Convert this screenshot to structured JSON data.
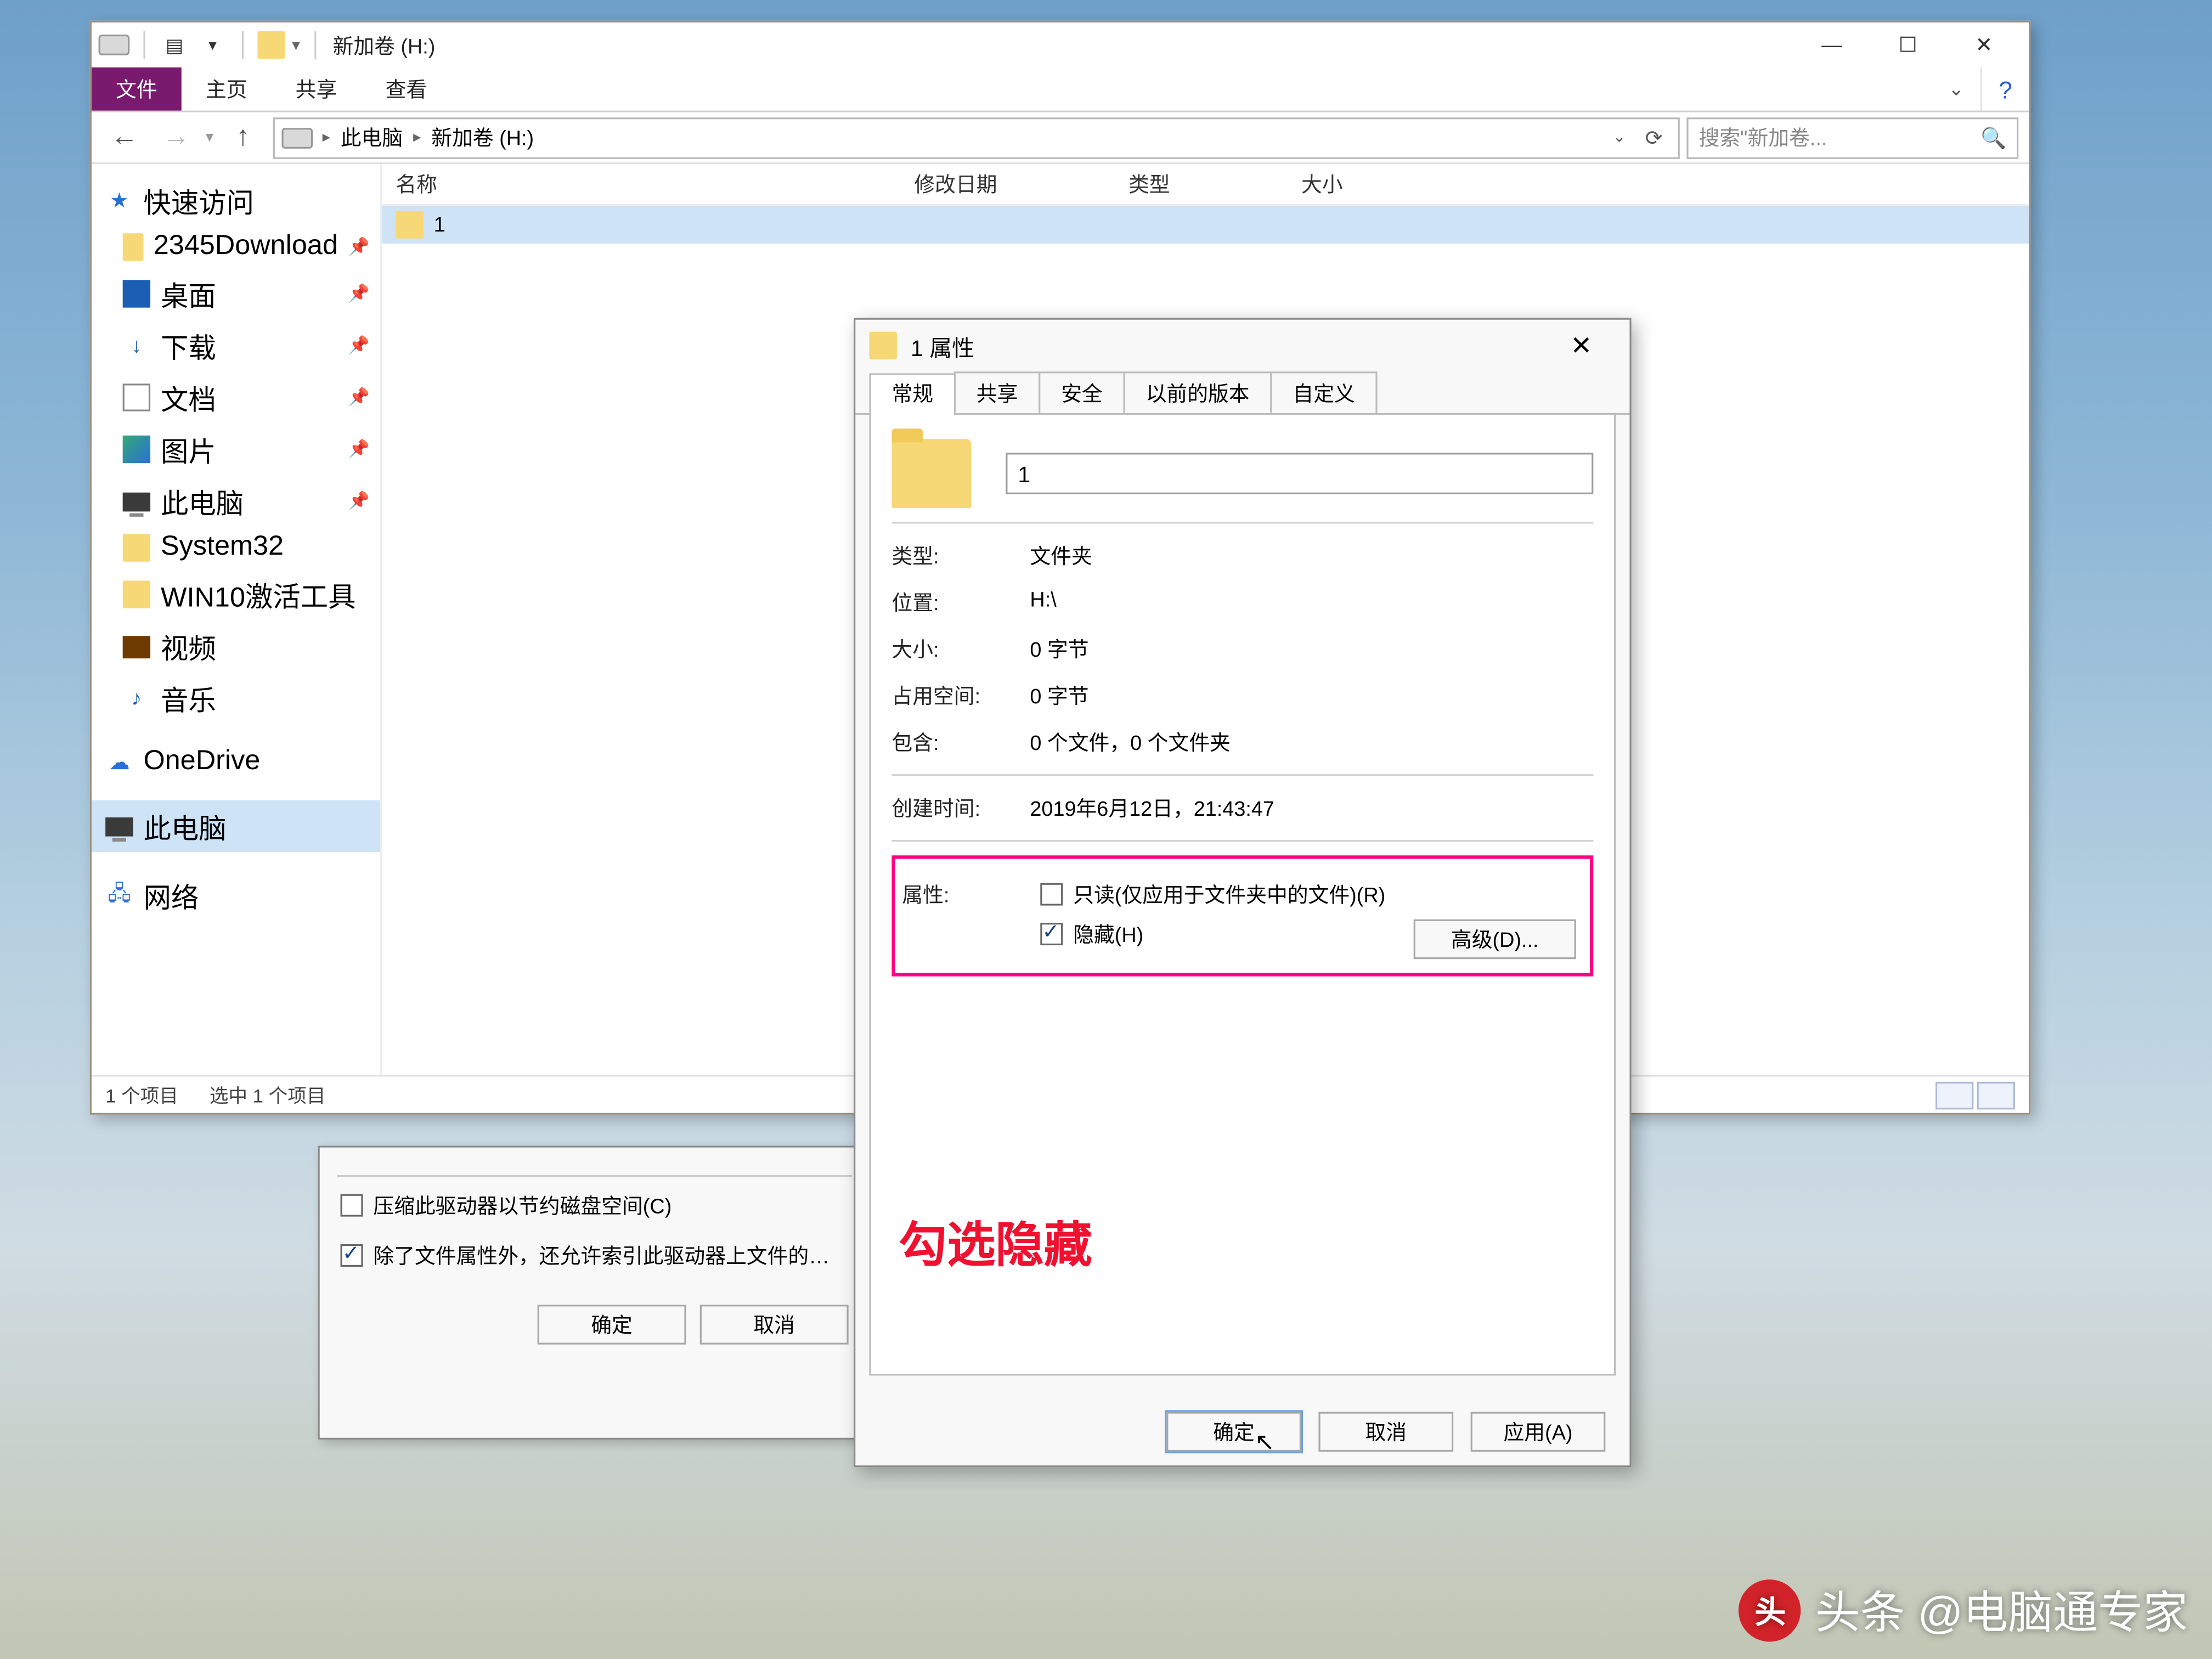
{
  "explorer": {
    "title": "新加卷 (H:)",
    "ribbon": {
      "file": "文件",
      "home": "主页",
      "share": "共享",
      "view": "查看"
    },
    "breadcrumb": {
      "a": "此电脑",
      "b": "新加卷 (H:)"
    },
    "search_placeholder": "搜索\"新加卷...",
    "columns": {
      "name": "名称",
      "date": "修改日期",
      "type": "类型",
      "size": "大小"
    },
    "sidebar": {
      "quick": "快速访问",
      "items": [
        {
          "label": "2345Download"
        },
        {
          "label": "桌面"
        },
        {
          "label": "下载"
        },
        {
          "label": "文档"
        },
        {
          "label": "图片"
        },
        {
          "label": "此电脑"
        },
        {
          "label": "System32"
        },
        {
          "label": "WIN10激活工具"
        },
        {
          "label": "视频"
        },
        {
          "label": "音乐"
        }
      ],
      "onedrive": "OneDrive",
      "thispc": "此电脑",
      "network": "网络"
    },
    "file_row_name": "1",
    "status": {
      "count": "1 个项目",
      "sel": "选中 1 个项目"
    }
  },
  "driveprops": {
    "compress": "压缩此驱动器以节约磁盘空间(C)",
    "index": "除了文件属性外，还允许索引此驱动器上文件的…",
    "ok": "确定",
    "cancel": "取消"
  },
  "props": {
    "title": "1 属性",
    "tabs": {
      "general": "常规",
      "share": "共享",
      "security": "安全",
      "prev": "以前的版本",
      "custom": "自定义"
    },
    "name_value": "1",
    "rows": {
      "type_l": "类型:",
      "type_v": "文件夹",
      "loc_l": "位置:",
      "loc_v": "H:\\",
      "size_l": "大小:",
      "size_v": "0 字节",
      "disk_l": "占用空间:",
      "disk_v": "0 字节",
      "cont_l": "包含:",
      "cont_v": "0 个文件，0 个文件夹",
      "ctime_l": "创建时间:",
      "ctime_v": "2019年6月12日，21:43:47",
      "attr_l": "属性:",
      "readonly": "只读(仅应用于文件夹中的文件)(R)",
      "hidden": "隐藏(H)",
      "advanced": "高级(D)..."
    },
    "ok": "确定",
    "cancel": "取消",
    "apply": "应用(A)",
    "annotation": "勾选隐藏"
  },
  "watermark": "头条 @电脑通专家"
}
